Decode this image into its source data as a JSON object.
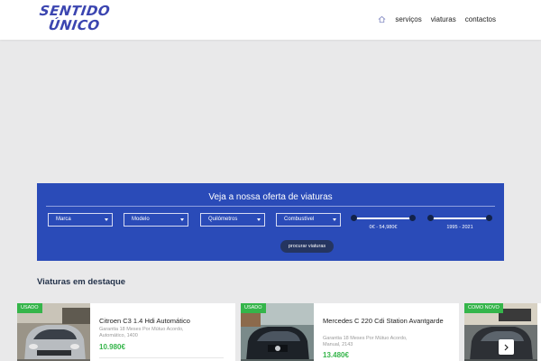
{
  "brand": {
    "line1": "SENTIDO",
    "line2": "ÚNICO"
  },
  "nav": {
    "home_icon": "home-icon",
    "items": [
      {
        "label": "serviços"
      },
      {
        "label": "viaturas"
      },
      {
        "label": "contactos"
      }
    ]
  },
  "search": {
    "title": "Veja a nossa oferta de viaturas",
    "selects": [
      {
        "label": "Marca"
      },
      {
        "label": "Modelo"
      },
      {
        "label": "Quilómetros"
      },
      {
        "label": "Combustível"
      }
    ],
    "price_range": {
      "label": "0€ - 54,980€",
      "min": 0,
      "max": 54980
    },
    "year_range": {
      "label": "1995 - 2021",
      "min": 1995,
      "max": 2021
    },
    "button_label": "procurar viaturas"
  },
  "featured": {
    "title": "Viaturas em destaque",
    "cards": [
      {
        "badge": "USADO",
        "title": "Citroen C3 1.4 Hdi Automático",
        "desc": "Garantia 18 Meses Por Mútuo Acordo, Automático, 1400",
        "price": "10.980€"
      },
      {
        "badge": "USADO",
        "title": "Mercedes C 220 Cdi Station Avantgarde",
        "desc": "Garantia 18 Meses Por Mútuo Acordo, Manual, 2143",
        "price": "13.480€"
      },
      {
        "badge": "COMO NOVO",
        "title": "",
        "desc": "",
        "price": ""
      }
    ]
  },
  "colors": {
    "accent": "#2a4bb8",
    "badge": "#35b54a",
    "price": "#35b54a",
    "button": "#253560"
  }
}
